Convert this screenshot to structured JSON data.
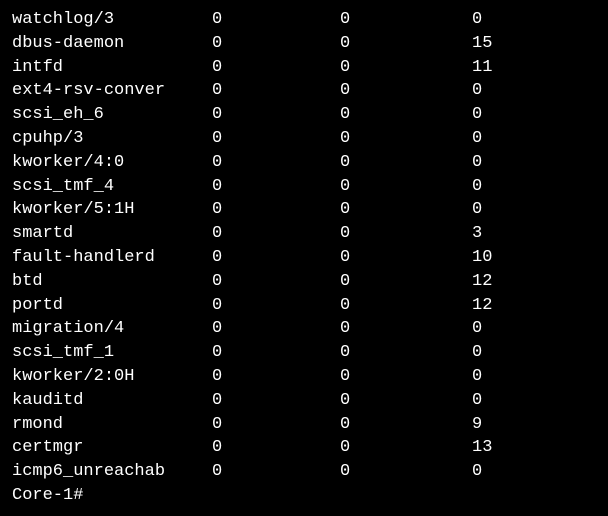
{
  "rows": [
    {
      "name": "watchlog/3",
      "a": 0,
      "b": 0,
      "c": 0
    },
    {
      "name": "dbus-daemon",
      "a": 0,
      "b": 0,
      "c": 15
    },
    {
      "name": "intfd",
      "a": 0,
      "b": 0,
      "c": 11
    },
    {
      "name": "ext4-rsv-conver",
      "a": 0,
      "b": 0,
      "c": 0
    },
    {
      "name": "scsi_eh_6",
      "a": 0,
      "b": 0,
      "c": 0
    },
    {
      "name": "cpuhp/3",
      "a": 0,
      "b": 0,
      "c": 0
    },
    {
      "name": "kworker/4:0",
      "a": 0,
      "b": 0,
      "c": 0
    },
    {
      "name": "scsi_tmf_4",
      "a": 0,
      "b": 0,
      "c": 0
    },
    {
      "name": "kworker/5:1H",
      "a": 0,
      "b": 0,
      "c": 0
    },
    {
      "name": "smartd",
      "a": 0,
      "b": 0,
      "c": 3
    },
    {
      "name": "fault-handlerd",
      "a": 0,
      "b": 0,
      "c": 10
    },
    {
      "name": "btd",
      "a": 0,
      "b": 0,
      "c": 12
    },
    {
      "name": "portd",
      "a": 0,
      "b": 0,
      "c": 12
    },
    {
      "name": "migration/4",
      "a": 0,
      "b": 0,
      "c": 0
    },
    {
      "name": "scsi_tmf_1",
      "a": 0,
      "b": 0,
      "c": 0
    },
    {
      "name": "kworker/2:0H",
      "a": 0,
      "b": 0,
      "c": 0
    },
    {
      "name": "kauditd",
      "a": 0,
      "b": 0,
      "c": 0
    },
    {
      "name": "rmond",
      "a": 0,
      "b": 0,
      "c": 9
    },
    {
      "name": "certmgr",
      "a": 0,
      "b": 0,
      "c": 13
    },
    {
      "name": "icmp6_unreachab",
      "a": 0,
      "b": 0,
      "c": 0
    }
  ],
  "prompt": "Core-1#"
}
